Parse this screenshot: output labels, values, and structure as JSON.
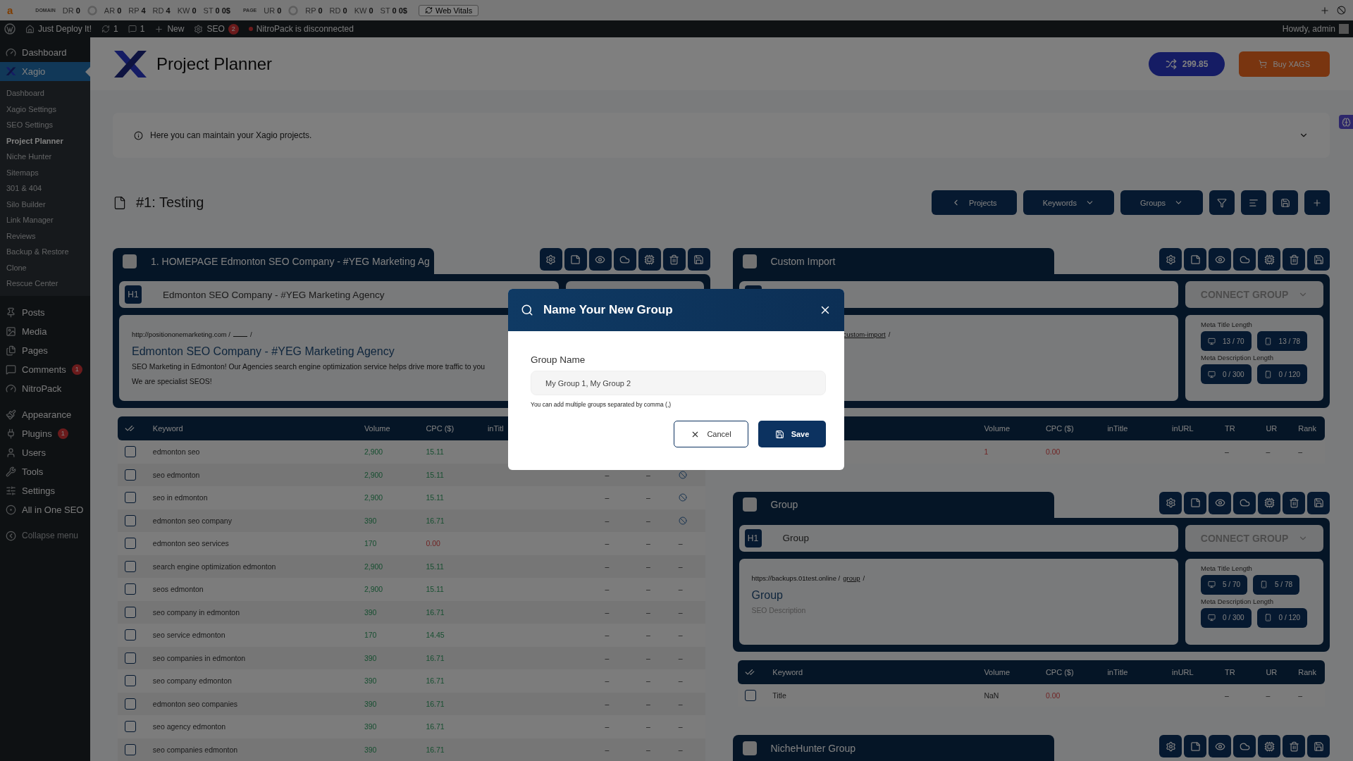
{
  "seo_toolbar": {
    "logo": "a",
    "groups": [
      {
        "label": "DOMAIN",
        "metrics": [
          {
            "name": "DR",
            "value": "0",
            "indicator": true
          },
          {
            "name": "AR",
            "value": "0"
          },
          {
            "name": "RP",
            "value": "4"
          },
          {
            "name": "RD",
            "value": "4"
          },
          {
            "name": "KW",
            "value": "0"
          },
          {
            "name": "ST",
            "value": "0",
            "extra": "0$"
          }
        ]
      },
      {
        "label": "PAGE",
        "metrics": [
          {
            "name": "UR",
            "value": "0",
            "indicator": true
          },
          {
            "name": "RP",
            "value": "0"
          },
          {
            "name": "RD",
            "value": "0"
          },
          {
            "name": "KW",
            "value": "0"
          },
          {
            "name": "ST",
            "value": "0",
            "extra": "0$"
          }
        ]
      }
    ],
    "button": "Web Vitals"
  },
  "admin_bar": {
    "site": "Just Deploy It!",
    "updates": "1",
    "comments": "1",
    "new": "New",
    "seo": {
      "label": "SEO",
      "count": "2"
    },
    "notice": "NitroPack is disconnected",
    "greeting": "Howdy, admin"
  },
  "sidebar": {
    "sections": [
      {
        "items": [
          {
            "label": "Dashboard",
            "selected": false
          },
          {
            "label": "Xagio",
            "selected": true,
            "children": [
              {
                "label": "Dashboard",
                "selected": false
              },
              {
                "label": "Xagio Settings",
                "selected": false
              },
              {
                "label": "SEO Settings",
                "selected": false
              },
              {
                "label": "Project Planner",
                "selected": true
              },
              {
                "label": "Niche Hunter",
                "selected": false
              },
              {
                "label": "Sitemaps",
                "selected": false
              },
              {
                "label": "301 & 404",
                "selected": false
              },
              {
                "label": "Silo Builder",
                "selected": false
              },
              {
                "label": "Link Manager",
                "selected": false
              },
              {
                "label": "Reviews",
                "selected": false
              },
              {
                "label": "Backup & Restore",
                "selected": false
              },
              {
                "label": "Clone",
                "selected": false
              },
              {
                "label": "Rescue Center",
                "selected": false
              }
            ]
          }
        ]
      },
      {
        "items": [
          {
            "label": "Posts",
            "selected": false
          },
          {
            "label": "Media",
            "selected": false
          },
          {
            "label": "Pages",
            "selected": false
          },
          {
            "label": "Comments",
            "selected": false,
            "count": "1"
          },
          {
            "label": "NitroPack",
            "selected": false
          }
        ]
      },
      {
        "items": [
          {
            "label": "Appearance",
            "selected": false
          },
          {
            "label": "Plugins",
            "selected": false,
            "count": "1"
          },
          {
            "label": "Users",
            "selected": false
          },
          {
            "label": "Tools",
            "selected": false
          },
          {
            "label": "Settings",
            "selected": false
          },
          {
            "label": "All in One SEO",
            "selected": false
          }
        ]
      }
    ],
    "collapse": "Collapse menu"
  },
  "header": {
    "title": "Project Planner",
    "balance": "299.85",
    "buy": "Buy XAGS"
  },
  "info": "Here you can maintain your Xagio projects.",
  "project": {
    "title": "#1: Testing",
    "buttons": [
      {
        "label": "Projects",
        "kind": "back"
      },
      {
        "label": "Keywords",
        "kind": "menu"
      },
      {
        "label": "Groups",
        "kind": "menu"
      }
    ]
  },
  "card_columns": [
    [
      {
        "title": "1. HOMEPAGE Edmonton SEO Company - #YEG Marketing Ag",
        "checked": false,
        "h1": {
          "badge": "H1",
          "text": "Edmonton SEO Company - #YEG Marketing Agency"
        },
        "url": {
          "base": "http://positiononemarketing.com /",
          "end": "/"
        },
        "seo_title": "Edmonton SEO Company - #YEG Marketing Agency",
        "seo_description": [
          "SEO Marketing in Edmonton! Our Agencies search engine optimization service helps drive more traffic to you",
          "We are specialist SEOS!"
        ],
        "description_placeholder": false,
        "table": {
          "columns": [
            {
              "kind": "keyword",
              "label": "Keyword"
            },
            {
              "kind": "volume",
              "label": "Volume"
            },
            {
              "kind": "cpc",
              "label": "CPC ($)"
            },
            {
              "kind": "intitle",
              "label": "inTitl"
            }
          ],
          "rows": [
            {
              "checked": false,
              "keyword": "edmonton seo",
              "volume": {
                "text": "2,900",
                "kind": "good"
              },
              "cpc": {
                "text": "15.11",
                "kind": "good"
              }
            },
            {
              "checked": false,
              "keyword": "seo edmonton",
              "volume": {
                "text": "2,900",
                "kind": "good"
              },
              "cpc": {
                "text": "15.11",
                "kind": "good"
              },
              "tr": "–",
              "ur": "–",
              "rank_icon": true
            },
            {
              "checked": false,
              "keyword": "seo in edmonton",
              "volume": {
                "text": "2,900",
                "kind": "good"
              },
              "cpc": {
                "text": "15.11",
                "kind": "good"
              },
              "tr": "–",
              "ur": "–",
              "rank_icon": true
            },
            {
              "checked": false,
              "keyword": "edmonton seo company",
              "volume": {
                "text": "390",
                "kind": "good"
              },
              "cpc": {
                "text": "16.71",
                "kind": "good"
              },
              "tr": "–",
              "ur": "–",
              "rank_icon": true
            },
            {
              "checked": false,
              "keyword": "edmonton seo services",
              "volume": {
                "text": "170",
                "kind": "good"
              },
              "cpc": {
                "text": "0.00",
                "kind": "bad"
              },
              "tr": "–",
              "ur": "–",
              "rank": "–"
            },
            {
              "checked": false,
              "keyword": "search engine optimization edmonton",
              "volume": {
                "text": "2,900",
                "kind": "good"
              },
              "cpc": {
                "text": "15.11",
                "kind": "good"
              },
              "tr": "–",
              "ur": "–",
              "rank": "–"
            },
            {
              "checked": false,
              "keyword": "seos edmonton",
              "volume": {
                "text": "2,900",
                "kind": "good"
              },
              "cpc": {
                "text": "15.11",
                "kind": "good"
              },
              "tr": "–",
              "ur": "–",
              "rank": "–"
            },
            {
              "checked": false,
              "keyword": "seo company in edmonton",
              "volume": {
                "text": "390",
                "kind": "good"
              },
              "cpc": {
                "text": "16.71",
                "kind": "good"
              },
              "tr": "–",
              "ur": "–",
              "rank": "–"
            },
            {
              "checked": false,
              "keyword": "seo service edmonton",
              "volume": {
                "text": "170",
                "kind": "good"
              },
              "cpc": {
                "text": "14.45",
                "kind": "good"
              },
              "tr": "–",
              "ur": "–",
              "rank": "–"
            },
            {
              "checked": false,
              "keyword": "seo companies in edmonton",
              "volume": {
                "text": "390",
                "kind": "good"
              },
              "cpc": {
                "text": "16.71",
                "kind": "good"
              },
              "tr": "–",
              "ur": "–",
              "rank": "–"
            },
            {
              "checked": false,
              "keyword": "seo company edmonton",
              "volume": {
                "text": "390",
                "kind": "good"
              },
              "cpc": {
                "text": "16.71",
                "kind": "good"
              },
              "tr": "–",
              "ur": "–",
              "rank": "–"
            },
            {
              "checked": false,
              "keyword": "edmonton seo companies",
              "volume": {
                "text": "390",
                "kind": "good"
              },
              "cpc": {
                "text": "16.71",
                "kind": "good"
              },
              "tr": "–",
              "ur": "–",
              "rank": "–"
            },
            {
              "checked": false,
              "keyword": "seo agency edmonton",
              "volume": {
                "text": "390",
                "kind": "good"
              },
              "cpc": {
                "text": "16.71",
                "kind": "good"
              },
              "tr": "–",
              "ur": "–",
              "rank": "–"
            },
            {
              "checked": false,
              "keyword": "seo companies edmonton",
              "volume": {
                "text": "390",
                "kind": "good"
              },
              "cpc": {
                "text": "16.71",
                "kind": "good"
              },
              "tr": "–",
              "ur": "–",
              "rank": "–"
            }
          ]
        }
      }
    ],
    [
      {
        "title": "Custom Import",
        "checked": false,
        "connect": "CONNECT GROUP",
        "url": {
          "slug": "custom-import",
          "end": "/"
        },
        "meta": {
          "title_label": "Meta Title Length",
          "title_values": [
            "13 / 70",
            "13 / 78"
          ],
          "desc_label": "Meta Description Length",
          "desc_values": [
            "0 / 300",
            "0 / 120"
          ]
        },
        "table": {
          "columns": [
            {
              "kind": "volume",
              "label": "Volume"
            },
            {
              "kind": "cpc",
              "label": "CPC ($)"
            },
            {
              "kind": "intitle",
              "label": "inTitle"
            },
            {
              "kind": "inurl",
              "label": "inURL"
            },
            {
              "kind": "tr",
              "label": "TR"
            },
            {
              "kind": "ur",
              "label": "UR"
            },
            {
              "kind": "rank",
              "label": "Rank"
            }
          ],
          "rows": [
            {
              "volume": {
                "text": "1",
                "kind": "bad"
              },
              "cpc": {
                "text": "0.00",
                "kind": "bad"
              },
              "tr": "–",
              "ur": "–",
              "rank": "–"
            }
          ]
        }
      },
      {
        "title": "Group",
        "checked": false,
        "h1": {
          "badge": "H1",
          "text": "Group"
        },
        "connect": "CONNECT GROUP",
        "url": {
          "base": "https://backups.01test.online /",
          "slug": "group",
          "end": "/"
        },
        "seo_title": "Group",
        "seo_description": [
          "SEO Description"
        ],
        "description_placeholder": true,
        "meta": {
          "title_label": "Meta Title Length",
          "title_values": [
            "5 / 70",
            "5 / 78"
          ],
          "desc_label": "Meta Description Length",
          "desc_values": [
            "0 / 300",
            "0 / 120"
          ]
        },
        "table": {
          "columns": [
            {
              "kind": "keyword",
              "label": "Keyword"
            },
            {
              "kind": "volume",
              "label": "Volume"
            },
            {
              "kind": "cpc",
              "label": "CPC ($)"
            },
            {
              "kind": "intitle",
              "label": "inTitle"
            },
            {
              "kind": "inurl",
              "label": "inURL"
            },
            {
              "kind": "tr",
              "label": "TR"
            },
            {
              "kind": "ur",
              "label": "UR"
            },
            {
              "kind": "rank",
              "label": "Rank"
            }
          ],
          "rows": [
            {
              "checked": false,
              "keyword": "Title",
              "volume": {
                "text": "NaN",
                "kind": "plain"
              },
              "cpc": {
                "text": "0.00",
                "kind": "bad"
              },
              "tr": "–",
              "ur": "–",
              "rank": "–"
            }
          ]
        }
      },
      {
        "title": "NicheHunter Group",
        "checked": false
      }
    ]
  ],
  "modal": {
    "title": "Name Your New Group",
    "label": "Group Name",
    "placeholder": "My Group 1, My Group 2",
    "hint": "You can add multiple groups separated by comma (,)",
    "cancel": "Cancel",
    "save": "Save"
  }
}
